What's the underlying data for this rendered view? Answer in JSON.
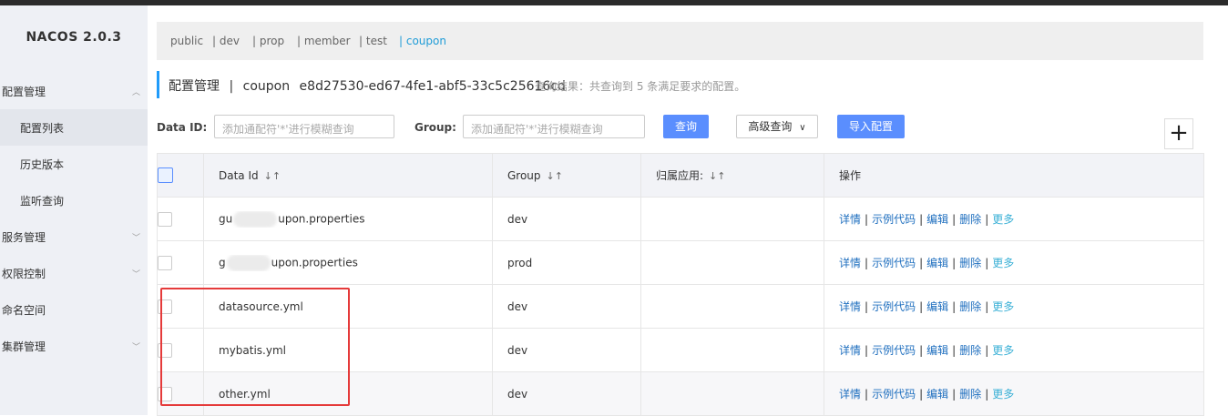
{
  "app": {
    "brand": "NACOS 2.0.3"
  },
  "sidebar": {
    "items": [
      {
        "label": "配置管理",
        "chevron": "︿"
      },
      {
        "label": "配置列表"
      },
      {
        "label": "历史版本"
      },
      {
        "label": "监听查询"
      },
      {
        "label": "服务管理",
        "chevron": "﹀"
      },
      {
        "label": "权限控制",
        "chevron": "﹀"
      },
      {
        "label": "命名空间"
      },
      {
        "label": "集群管理",
        "chevron": "﹀"
      }
    ]
  },
  "namespaces": [
    "public",
    "| dev",
    "| prop",
    "| member",
    "| test",
    "| coupon"
  ],
  "page": {
    "section": "配置管理",
    "separator": "|",
    "namespace_name": "coupon",
    "namespace_id": "e8d27530-ed67-4fe1-abf5-33c5c25616cd",
    "hint": "查询结果：共查询到 5 条满足要求的配置。"
  },
  "filters": {
    "dataid_label": "Data ID:",
    "dataid_placeholder": "添加通配符'*'进行模糊查询",
    "group_label": "Group:",
    "group_placeholder": "添加通配符'*'进行模糊查询",
    "query_button": "查询",
    "advanced_button": "高级查询",
    "import_button": "导入配置",
    "add_button": "+"
  },
  "table": {
    "headers": {
      "dataid": "Data Id",
      "group": "Group",
      "app": "归属应用:",
      "ops": "操作"
    },
    "sort_glyph": "↓↑",
    "ops": {
      "detail": "详情",
      "sample": "示例代码",
      "edit": "编辑",
      "delete": "删除",
      "more": "更多"
    },
    "rows": [
      {
        "dataid_prefix": "gu",
        "dataid_suffix": "upon.properties",
        "group": "dev",
        "app": ""
      },
      {
        "dataid_prefix": "g",
        "dataid_suffix": "upon.properties",
        "group": "prod",
        "app": ""
      },
      {
        "dataid": "datasource.yml",
        "group": "dev",
        "app": ""
      },
      {
        "dataid": "mybatis.yml",
        "group": "dev",
        "app": ""
      },
      {
        "dataid": "other.yml",
        "group": "dev",
        "app": ""
      }
    ]
  },
  "colors": {
    "accent": "#5a8efe",
    "active_ns": "#1f9cd7",
    "highlight": "#e53a3a"
  }
}
